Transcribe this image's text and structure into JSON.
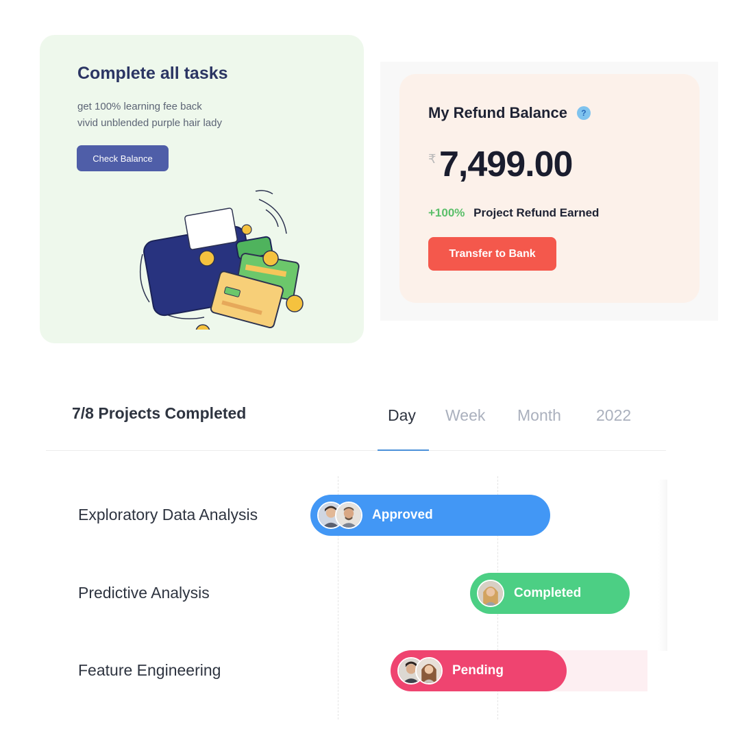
{
  "tasks_card": {
    "title": "Complete all tasks",
    "subtitle_line1": "get 100% learning fee back",
    "subtitle_line2": "vivid unblended purple hair lady",
    "button_label": "Check Balance",
    "illustration": "wallet-with-cards-and-coins"
  },
  "refund_card": {
    "title": "My Refund Balance",
    "help_icon": "?",
    "currency_symbol": "₹",
    "amount": "7,499.00",
    "earned_percent": "+100%",
    "earned_label": "Project Refund Earned",
    "button_label": "Transfer to Bank"
  },
  "projects": {
    "title": "7/8 Projects Completed",
    "tabs": [
      {
        "label": "Day",
        "active": true
      },
      {
        "label": "Week",
        "active": false
      },
      {
        "label": "Month",
        "active": false
      },
      {
        "label": "2022",
        "active": false
      }
    ],
    "rows": [
      {
        "name": "Exploratory Data Analysis",
        "status": "Approved",
        "color": "#4297f5",
        "avatars": 2
      },
      {
        "name": "Predictive Analysis",
        "status": "Completed",
        "color": "#4ccf84",
        "avatars": 1
      },
      {
        "name": "Feature Engineering",
        "status": "Pending",
        "color": "#ef4470",
        "avatars": 2
      }
    ]
  },
  "colors": {
    "tasks_bg": "#eef8ec",
    "primary_button": "#4f5ea8",
    "refund_bg": "#fcf1ea",
    "transfer_button": "#f4584c",
    "positive": "#5bbf6a"
  }
}
